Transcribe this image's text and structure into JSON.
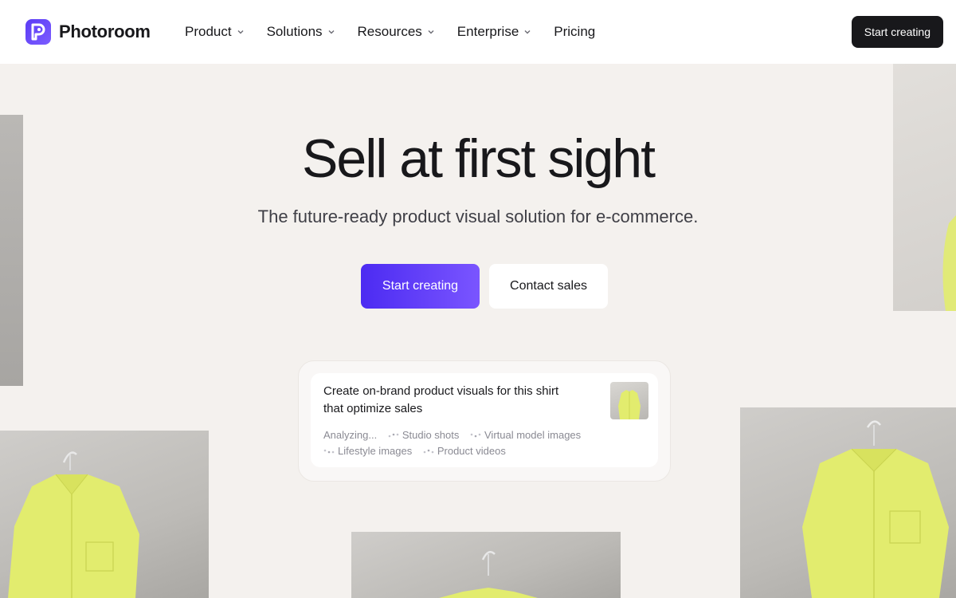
{
  "brand": {
    "name": "Photoroom",
    "logo_icon": "photoroom-logo-icon",
    "accent": "#5b3cf5"
  },
  "nav": {
    "items": [
      {
        "label": "Product",
        "has_dropdown": true
      },
      {
        "label": "Solutions",
        "has_dropdown": true
      },
      {
        "label": "Resources",
        "has_dropdown": true
      },
      {
        "label": "Enterprise",
        "has_dropdown": true
      },
      {
        "label": "Pricing",
        "has_dropdown": false
      }
    ],
    "cta_label": "Start creating"
  },
  "hero": {
    "title": "Sell at first sight",
    "subtitle": "The future-ready product visual solution for e-commerce.",
    "primary_button": "Start creating",
    "secondary_button": "Contact sales"
  },
  "prompt_card": {
    "text": "Create on-brand product visuals for this shirt that optimize sales",
    "status": "Analyzing...",
    "tags": [
      "Studio shots",
      "Virtual model images",
      "Lifestyle images",
      "Product videos"
    ]
  },
  "colors": {
    "page_background": "#f4f1ee",
    "primary_gradient_start": "#4c2bf2",
    "primary_gradient_end": "#7a55ff",
    "dark_button": "#18181b",
    "shirt_yellow": "#e2ec6e"
  }
}
